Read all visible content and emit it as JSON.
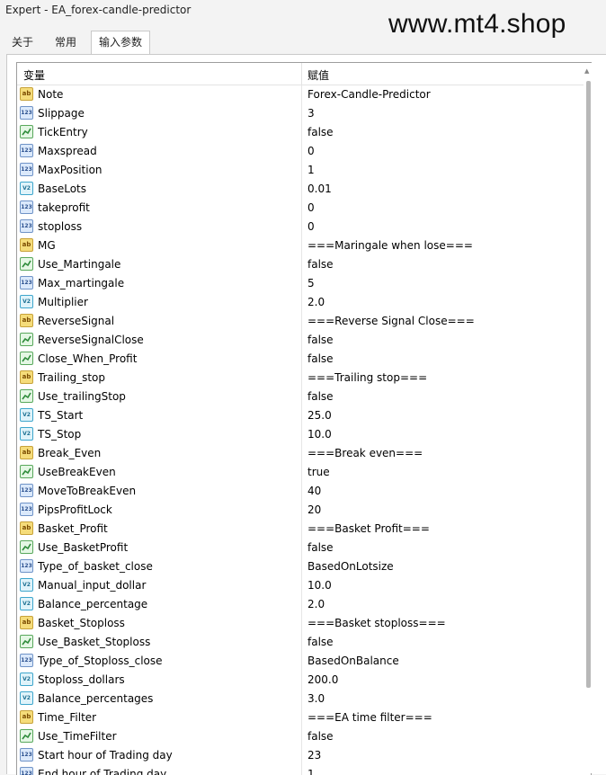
{
  "window": {
    "title": "Expert - EA_forex-candle-predictor"
  },
  "watermark": "www.mt4.shop",
  "tabs": [
    {
      "label": "关于"
    },
    {
      "label": "常用"
    },
    {
      "label": "输入参数"
    }
  ],
  "table": {
    "headers": {
      "variable": "变量",
      "value": "赋值"
    },
    "rows": [
      {
        "name": "Note",
        "value": "Forex-Candle-Predictor",
        "type": "ab"
      },
      {
        "name": "Slippage",
        "value": "3",
        "type": "123"
      },
      {
        "name": "TickEntry",
        "value": "false",
        "type": "bool"
      },
      {
        "name": "Maxspread",
        "value": "0",
        "type": "123"
      },
      {
        "name": "MaxPosition",
        "value": "1",
        "type": "123"
      },
      {
        "name": "BaseLots",
        "value": "0.01",
        "type": "dbl"
      },
      {
        "name": "takeprofit",
        "value": "0",
        "type": "123"
      },
      {
        "name": "stoploss",
        "value": "0",
        "type": "123"
      },
      {
        "name": "MG",
        "value": "===Maringale when lose===",
        "type": "ab"
      },
      {
        "name": "Use_Martingale",
        "value": "false",
        "type": "bool"
      },
      {
        "name": "Max_martingale",
        "value": "5",
        "type": "123"
      },
      {
        "name": "Multiplier",
        "value": "2.0",
        "type": "dbl"
      },
      {
        "name": "ReverseSignal",
        "value": "===Reverse Signal Close===",
        "type": "ab"
      },
      {
        "name": "ReverseSignalClose",
        "value": "false",
        "type": "bool"
      },
      {
        "name": "Close_When_Profit",
        "value": "false",
        "type": "bool"
      },
      {
        "name": "Trailing_stop",
        "value": "===Trailing stop===",
        "type": "ab"
      },
      {
        "name": "Use_trailingStop",
        "value": "false",
        "type": "bool"
      },
      {
        "name": "TS_Start",
        "value": "25.0",
        "type": "dbl"
      },
      {
        "name": "TS_Stop",
        "value": "10.0",
        "type": "dbl"
      },
      {
        "name": "Break_Even",
        "value": "===Break even===",
        "type": "ab"
      },
      {
        "name": "UseBreakEven",
        "value": "true",
        "type": "bool"
      },
      {
        "name": "MoveToBreakEven",
        "value": "40",
        "type": "123"
      },
      {
        "name": "PipsProfitLock",
        "value": "20",
        "type": "123"
      },
      {
        "name": "Basket_Profit",
        "value": "===Basket Profit===",
        "type": "ab"
      },
      {
        "name": "Use_BasketProfit",
        "value": "false",
        "type": "bool"
      },
      {
        "name": "Type_of_basket_close",
        "value": "BasedOnLotsize",
        "type": "123"
      },
      {
        "name": "Manual_input_dollar",
        "value": "10.0",
        "type": "dbl"
      },
      {
        "name": "Balance_percentage",
        "value": "2.0",
        "type": "dbl"
      },
      {
        "name": "Basket_Stoploss",
        "value": "===Basket stoploss===",
        "type": "ab"
      },
      {
        "name": "Use_Basket_Stoploss",
        "value": "false",
        "type": "bool"
      },
      {
        "name": "Type_of_Stoploss_close",
        "value": "BasedOnBalance",
        "type": "123"
      },
      {
        "name": "Stoploss_dollars",
        "value": "200.0",
        "type": "dbl"
      },
      {
        "name": "Balance_percentages",
        "value": "3.0",
        "type": "dbl"
      },
      {
        "name": "Time_Filter",
        "value": "===EA time filter===",
        "type": "ab"
      },
      {
        "name": "Use_TimeFilter",
        "value": "false",
        "type": "bool"
      },
      {
        "name": "Start hour of Trading day",
        "value": "23",
        "type": "123"
      },
      {
        "name": "End hour of Trading day",
        "value": "1",
        "type": "123"
      }
    ]
  },
  "icon_glyphs": {
    "ab": "ab",
    "123": "123",
    "dbl": "V2",
    "bool": ""
  },
  "colors": {
    "border": "#9e9e9e",
    "tab_active_bg": "#ffffff",
    "window_bg": "#f3f3f3"
  }
}
